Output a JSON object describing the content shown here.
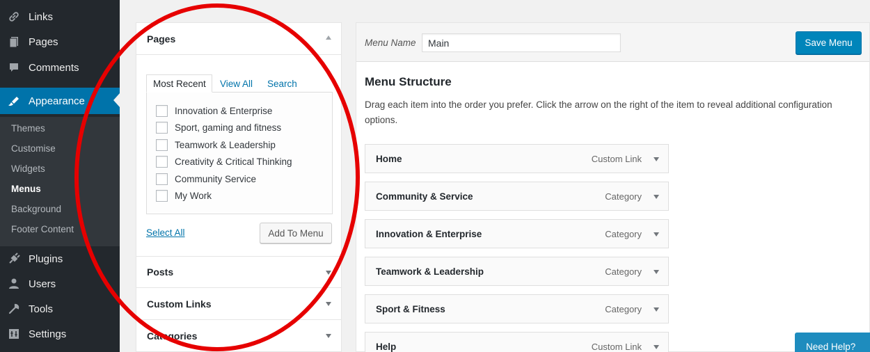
{
  "sidebar": {
    "items": [
      {
        "label": "Links",
        "icon": "link-icon"
      },
      {
        "label": "Pages",
        "icon": "pages-icon"
      },
      {
        "label": "Comments",
        "icon": "comments-icon"
      },
      {
        "label": "Appearance",
        "icon": "paintbrush-icon"
      },
      {
        "label": "Plugins",
        "icon": "plugin-icon"
      },
      {
        "label": "Users",
        "icon": "users-icon"
      },
      {
        "label": "Tools",
        "icon": "wrench-icon"
      },
      {
        "label": "Settings",
        "icon": "settings-icon"
      }
    ],
    "submenu": [
      "Themes",
      "Customise",
      "Widgets",
      "Menus",
      "Background",
      "Footer Content"
    ],
    "current_submenu": "Menus"
  },
  "add_items": {
    "pages": {
      "title": "Pages",
      "tabs": [
        "Most Recent",
        "View All",
        "Search"
      ],
      "active_tab": "Most Recent",
      "items": [
        "Innovation & Enterprise",
        "Sport, gaming and fitness",
        "Teamwork & Leadership",
        "Creativity & Critical Thinking",
        "Community Service",
        "My Work"
      ],
      "select_all": "Select All",
      "add_button": "Add To Menu"
    },
    "sections": [
      "Posts",
      "Custom Links",
      "Categories"
    ]
  },
  "menu": {
    "name_label": "Menu Name",
    "name_value": "Main",
    "save_button": "Save Menu",
    "structure_title": "Menu Structure",
    "structure_desc": "Drag each item into the order you prefer. Click the arrow on the right of the item to reveal additional configuration options.",
    "items": [
      {
        "title": "Home",
        "type": "Custom Link"
      },
      {
        "title": "Community & Service",
        "type": "Category"
      },
      {
        "title": "Innovation & Enterprise",
        "type": "Category"
      },
      {
        "title": "Teamwork & Leadership",
        "type": "Category"
      },
      {
        "title": "Sport & Fitness",
        "type": "Category"
      },
      {
        "title": "Help",
        "type": "Custom Link"
      }
    ]
  },
  "help_button": "Need Help?",
  "colors": {
    "sidebar_bg": "#23282d",
    "submenu_bg": "#32373c",
    "accent": "#0073aa",
    "primary_button": "#0085ba",
    "annotation": "#e60000"
  }
}
